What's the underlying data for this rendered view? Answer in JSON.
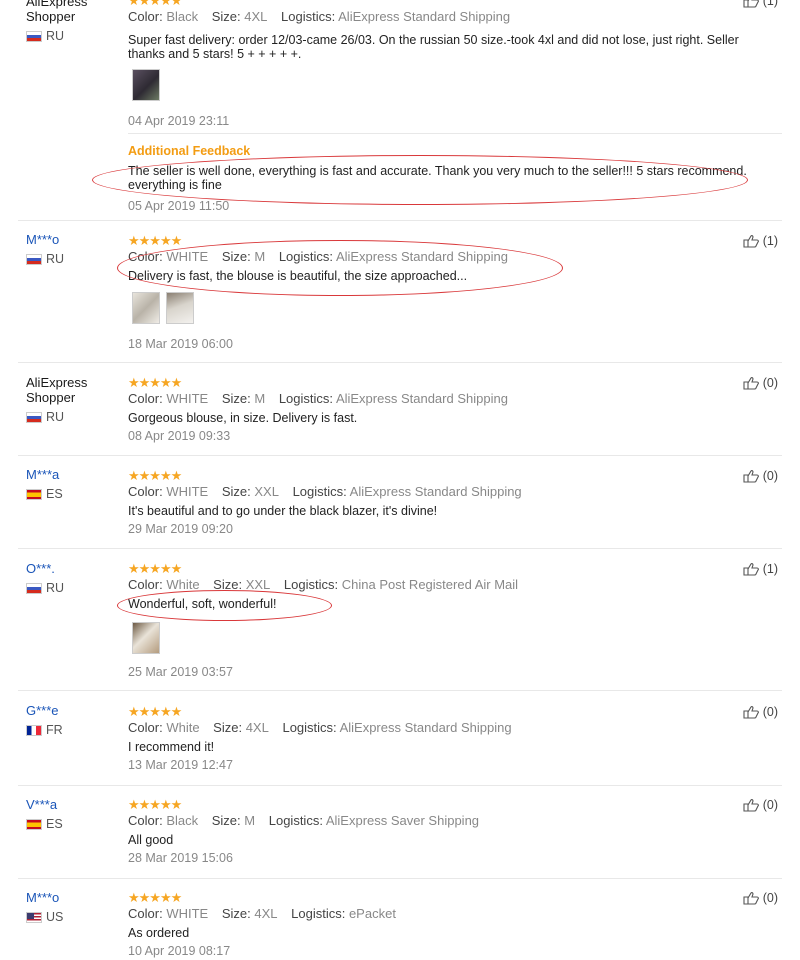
{
  "reviews": [
    {
      "user": [
        "AliExpress",
        "Shopper"
      ],
      "country": "RU",
      "flag": "ru",
      "stars": "★★★★★",
      "color_label": "Color:",
      "color": "Black",
      "size_label": "Size:",
      "size": "4XL",
      "logistics_label": "Logistics:",
      "logistics": "AliExpress Standard Shipping",
      "text": "Super fast delivery: order 12/03-came 26/03. On the russian 50 size.-took 4xl and did not lose, just right. Seller thanks and 5 stars! 5 + + + + +.",
      "date": "04 Apr 2019 23:11",
      "helpful": "(1)",
      "additional_title": "Additional Feedback",
      "additional_text": "The seller is well done, everything is fast and accurate. Thank you very much to the seller!!! 5 stars recommend. everything is fine",
      "additional_date": "05 Apr 2019 11:50"
    },
    {
      "user": [
        "M***o"
      ],
      "country": "RU",
      "flag": "ru",
      "stars": "★★★★★",
      "color_label": "Color:",
      "color": "WHITE",
      "size_label": "Size:",
      "size": "M",
      "logistics_label": "Logistics:",
      "logistics": "AliExpress Standard Shipping",
      "text": "Delivery is fast, the blouse is beautiful, the size approached...",
      "date": "18 Mar 2019 06:00",
      "helpful": "(1)"
    },
    {
      "user": [
        "AliExpress",
        "Shopper"
      ],
      "country": "RU",
      "flag": "ru",
      "stars": "★★★★★",
      "color_label": "Color:",
      "color": "WHITE",
      "size_label": "Size:",
      "size": "M",
      "logistics_label": "Logistics:",
      "logistics": "AliExpress Standard Shipping",
      "text": "Gorgeous blouse, in size. Delivery is fast.",
      "date": "08 Apr 2019 09:33",
      "helpful": "(0)"
    },
    {
      "user": [
        "M***a"
      ],
      "country": "ES",
      "flag": "es",
      "stars": "★★★★★",
      "color_label": "Color:",
      "color": "WHITE",
      "size_label": "Size:",
      "size": "XXL",
      "logistics_label": "Logistics:",
      "logistics": "AliExpress Standard Shipping",
      "text": "It's beautiful and to go under the black blazer, it's divine!",
      "date": "29 Mar 2019 09:20",
      "helpful": "(0)"
    },
    {
      "user": [
        "O***."
      ],
      "country": "RU",
      "flag": "ru",
      "stars": "★★★★★",
      "color_label": "Color:",
      "color": "White",
      "size_label": "Size:",
      "size": "XXL",
      "logistics_label": "Logistics:",
      "logistics": "China Post Registered Air Mail",
      "text": "Wonderful, soft, wonderful!",
      "date": "25 Mar 2019 03:57",
      "helpful": "(1)"
    },
    {
      "user": [
        "G***e"
      ],
      "country": "FR",
      "flag": "fr",
      "stars": "★★★★★",
      "color_label": "Color:",
      "color": "White",
      "size_label": "Size:",
      "size": "4XL",
      "logistics_label": "Logistics:",
      "logistics": "AliExpress Standard Shipping",
      "text": "I recommend it!",
      "date": "13 Mar 2019 12:47",
      "helpful": "(0)"
    },
    {
      "user": [
        "V***a"
      ],
      "country": "ES",
      "flag": "es",
      "stars": "★★★★★",
      "color_label": "Color:",
      "color": "Black",
      "size_label": "Size:",
      "size": "M",
      "logistics_label": "Logistics:",
      "logistics": "AliExpress Saver Shipping",
      "text": "All good",
      "date": "28 Mar 2019 15:06",
      "helpful": "(0)"
    },
    {
      "user": [
        "M***o"
      ],
      "country": "US",
      "flag": "us",
      "stars": "★★★★★",
      "color_label": "Color:",
      "color": "WHITE",
      "size_label": "Size:",
      "size": "4XL",
      "logistics_label": "Logistics:",
      "logistics": "ePacket",
      "text": "As ordered",
      "date": "10 Apr 2019 08:17",
      "helpful": "(0)"
    }
  ],
  "colors": {
    "link": "#1a55b8",
    "star": "#f6a623",
    "annotation": "#d9383a",
    "additional": "#f39c12"
  },
  "icons": {
    "helpful": "thumbs-up-icon"
  }
}
